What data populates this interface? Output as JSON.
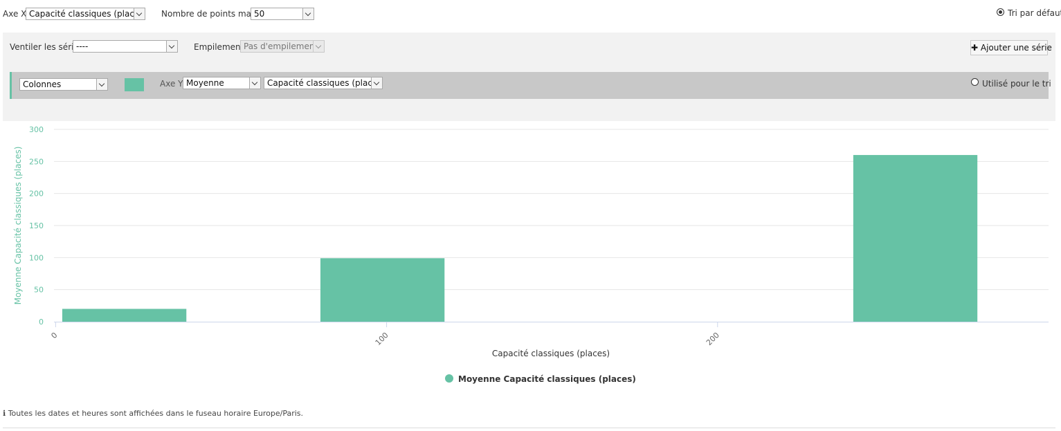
{
  "toolbar": {
    "x_axis_label": "Axe X",
    "x_axis_value": "Capacité classiques (places)",
    "max_points_label": "Nombre de points max.",
    "max_points_value": "50",
    "default_sort_label": "Tri par défaut"
  },
  "panel": {
    "breakdown_label": "Ventiler les séries",
    "breakdown_value": "----",
    "stacking_label": "Empilement",
    "stacking_value": "Pas d'empilement",
    "add_series_label": "Ajouter une série"
  },
  "series_row": {
    "type_value": "Colonnes",
    "color": "#66c2a5",
    "y_axis_label": "Axe Y",
    "aggregation_value": "Moyenne",
    "field_value": "Capacité classiques (places)",
    "sort_label": "Utilisé pour le tri"
  },
  "chart_data": {
    "type": "bar",
    "xlabel": "Capacité classiques (places)",
    "ylabel": "Moyenne Capacité classiques (places)",
    "xlim": [
      -0.5,
      300
    ],
    "ylim": [
      0,
      300
    ],
    "x_ticks": [
      0,
      100,
      200
    ],
    "y_ticks": [
      0,
      50,
      100,
      150,
      200,
      250,
      300
    ],
    "grid": true,
    "legend_position": "bottom",
    "series": [
      {
        "name": "Moyenne Capacité classiques (places)",
        "color": "#66c2a5",
        "bars": [
          {
            "x_start": 2,
            "x_end": 39.5,
            "value": 20
          },
          {
            "x_start": 80,
            "x_end": 117.5,
            "value": 99
          },
          {
            "x_start": 241,
            "x_end": 278.5,
            "value": 260
          }
        ]
      }
    ]
  },
  "footer": {
    "info_icon": "info-icon",
    "note": "Toutes les dates et heures sont affichées dans le fuseau horaire Europe/Paris."
  }
}
